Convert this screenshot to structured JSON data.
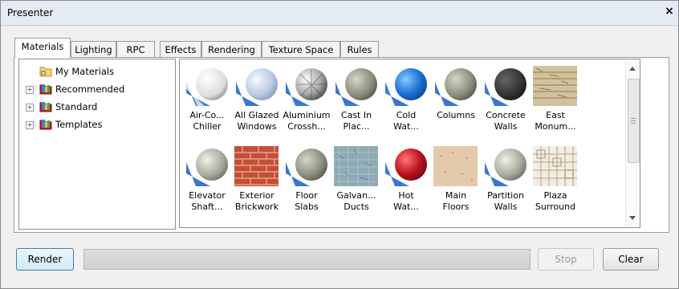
{
  "window": {
    "title": "Presenter",
    "close_label": "×"
  },
  "tabs": [
    {
      "label": "Materials"
    },
    {
      "label": "Lighting"
    },
    {
      "label": "RPC"
    },
    {
      "label": "Effects"
    },
    {
      "label": "Rendering"
    },
    {
      "label": "Texture Space"
    },
    {
      "label": "Rules"
    }
  ],
  "active_tab": "Materials",
  "tree": [
    {
      "label": "My Materials",
      "icon": "folder-icon",
      "expandable": false
    },
    {
      "label": "Recommended",
      "icon": "library-icon",
      "expandable": true
    },
    {
      "label": "Standard",
      "icon": "library-icon",
      "expandable": true
    },
    {
      "label": "Templates",
      "icon": "library-icon",
      "expandable": true
    }
  ],
  "materials": [
    {
      "label": "Air-Co...\nChiller",
      "type": "sphere-white"
    },
    {
      "label": "All Glazed\nWindows",
      "type": "sphere-glass"
    },
    {
      "label": "Aluminium\nCrossh...",
      "type": "sphere-chrome"
    },
    {
      "label": "Cast In\nPlac...",
      "type": "sphere-gray"
    },
    {
      "label": "Cold\nWat...",
      "type": "sphere-blue"
    },
    {
      "label": "Columns",
      "type": "sphere-gray"
    },
    {
      "label": "Concrete\nWalls",
      "type": "sphere-dark"
    },
    {
      "label": "East\nMonum...",
      "type": "stone-texture"
    },
    {
      "label": "Elevator\nShaft...",
      "type": "sphere-light"
    },
    {
      "label": "Exterior\nBrickwork",
      "type": "brick-texture"
    },
    {
      "label": "Floor\nSlabs",
      "type": "sphere-gray"
    },
    {
      "label": "Galvan...\nDucts",
      "type": "galvanized-texture"
    },
    {
      "label": "Hot\nWat...",
      "type": "sphere-red"
    },
    {
      "label": "Main\nFloors",
      "type": "beige-texture"
    },
    {
      "label": "Partition\nWalls",
      "type": "sphere-light"
    },
    {
      "label": "Plaza\nSurround",
      "type": "tile-texture"
    }
  ],
  "buttons": {
    "render": "Render",
    "stop": "Stop",
    "clear": "Clear"
  },
  "colors": {
    "blue": "#1f73d6",
    "red": "#bb1520",
    "accent": "#3c7fb1"
  }
}
